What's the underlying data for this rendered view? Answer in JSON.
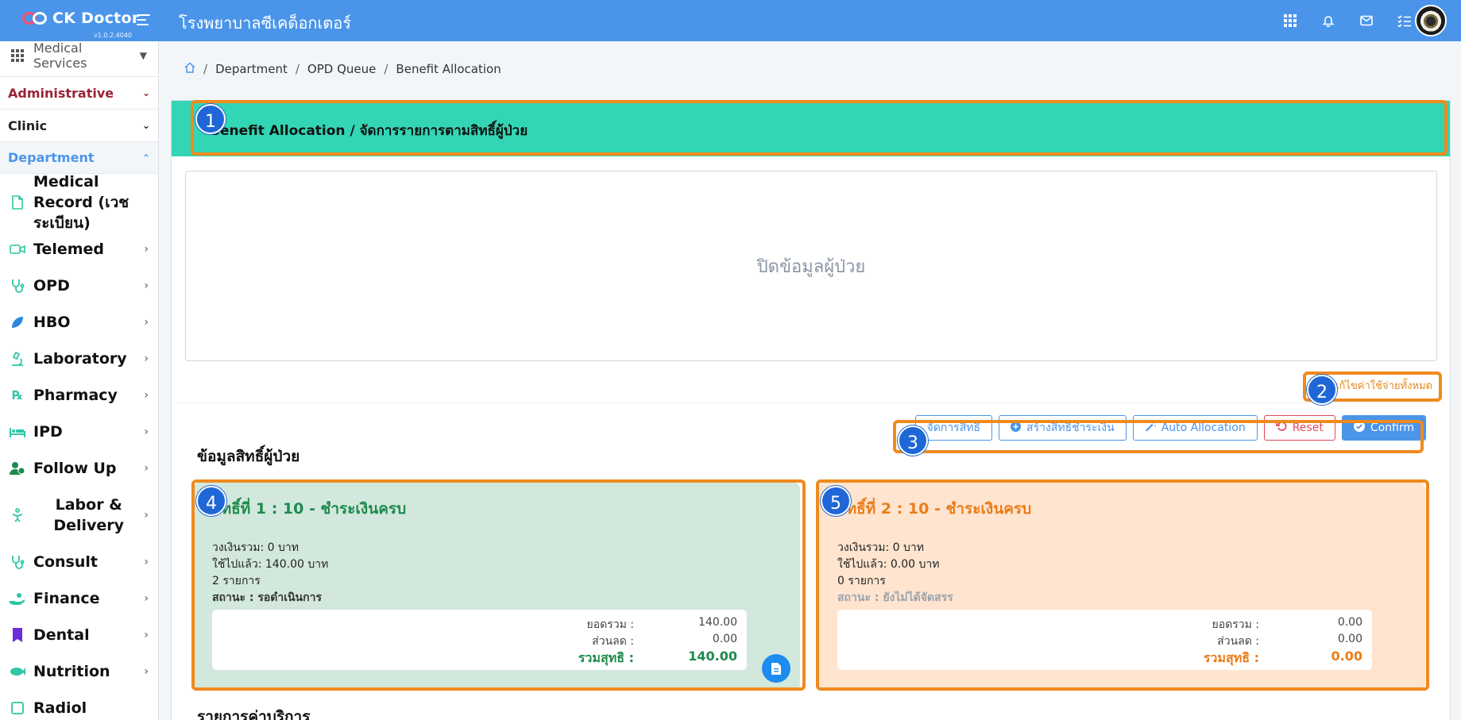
{
  "app": {
    "brand": "CK Doctor",
    "version": "v1.0.2.4040",
    "hospital_name": "โรงพยาบาลซีเคด็อกเตอร์"
  },
  "sidebar": {
    "service_menu": "Medical Services",
    "sections": [
      {
        "label": "Administrative"
      },
      {
        "label": "Clinic"
      },
      {
        "label": "Department"
      }
    ],
    "items": [
      {
        "label": "Medical Record (เวชระเบียน)",
        "icon": "file-icon"
      },
      {
        "label": "Telemed",
        "icon": "video-icon"
      },
      {
        "label": "OPD",
        "icon": "stethoscope-icon"
      },
      {
        "label": "HBO",
        "icon": "leaf-icon"
      },
      {
        "label": "Laboratory",
        "icon": "microscope-icon"
      },
      {
        "label": "Pharmacy",
        "icon": "rx-icon"
      },
      {
        "label": "IPD",
        "icon": "bed-icon"
      },
      {
        "label": "Follow Up",
        "icon": "user-clock-icon"
      },
      {
        "label": "Labor & Delivery",
        "icon": "baby-icon"
      },
      {
        "label": "Consult",
        "icon": "stethoscope-icon"
      },
      {
        "label": "Finance",
        "icon": "hand-coin-icon"
      },
      {
        "label": "Dental",
        "icon": "bookmark-icon"
      },
      {
        "label": "Nutrition",
        "icon": "fish-icon"
      },
      {
        "label": "Radiol",
        "icon": "xray-icon"
      }
    ]
  },
  "breadcrumb": {
    "items": [
      "Department",
      "OPD Queue",
      "Benefit Allocation"
    ]
  },
  "page": {
    "title": "Benefit Allocation / จัดการรายการตามสิทธิ์ผู้ป่วย",
    "patient_placeholder": "ปิดข้อมูลผู้ป่วย",
    "cost_link": "แก้ไขค่าใช้จ่ายทั้งหมด",
    "section_title": "ข้อมูลสิทธิ์ผู้ป่วย",
    "services_title": "รายการค่าบริการ"
  },
  "toolbar": {
    "manage": "จัดการสิทธิ",
    "create": "สร้างสิทธิชำระเงิน",
    "auto": "Auto Allocation",
    "reset": "Reset",
    "confirm": "Confirm"
  },
  "cards": [
    {
      "title": "สิทธิ์ที่ 1 : 10 - ชำระเงินครบ",
      "limit": "วงเงินรวม: 0 บาท",
      "used": "ใช้ไปแล้ว: 140.00 บาท",
      "count": "2 รายการ",
      "status": "สถานะ : รอดำเนินการ",
      "total_label": "ยอดรวม :",
      "total": "140.00",
      "discount_label": "ส่วนลด :",
      "discount": "0.00",
      "net_label": "รวมสุทธิ :",
      "net": "140.00"
    },
    {
      "title": "สิทธิ์ที่ 2 : 10 - ชำระเงินครบ",
      "limit": "วงเงินรวม: 0 บาท",
      "used": "ใช้ไปแล้ว: 0.00 บาท",
      "count": "0 รายการ",
      "status": "สถานะ : ยังไม่ได้จัดสรร",
      "total_label": "ยอดรวม :",
      "total": "0.00",
      "discount_label": "ส่วนลด :",
      "discount": "0.00",
      "net_label": "รวมสุทธิ :",
      "net": "0.00"
    }
  ],
  "annotations": [
    "1",
    "2",
    "3",
    "4",
    "5"
  ],
  "colors": {
    "topbar": "#4a95ea",
    "header_teal": "#32d6b4",
    "highlight": "#ef8a1e",
    "badge": "#1f67d6",
    "card_green": "#d2e8dd",
    "card_orange": "#ffe4cf"
  }
}
